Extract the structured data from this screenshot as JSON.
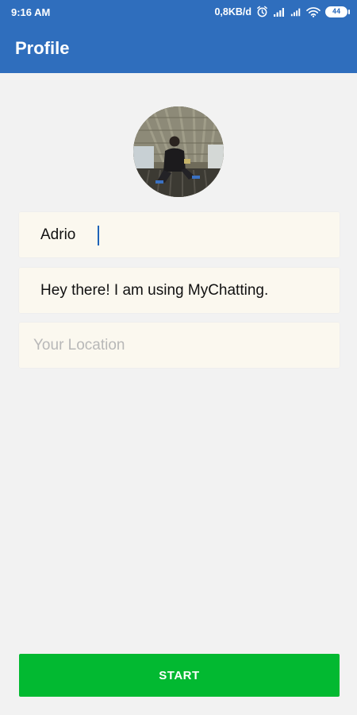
{
  "status_bar": {
    "time": "9:16 AM",
    "net_speed": "0,8KB/d",
    "battery": "44",
    "icons": [
      "alarm-icon",
      "signal-icon",
      "signal-icon",
      "wifi-icon",
      "battery-icon"
    ]
  },
  "toolbar": {
    "title": "Profile"
  },
  "avatar": {
    "icon": "profile-photo"
  },
  "form": {
    "name_value": "Adrio",
    "status_value": "Hey there! I am using MyChatting.",
    "location_value": "",
    "location_placeholder": "Your Location"
  },
  "start_button": {
    "label": "START"
  },
  "colors": {
    "app_bar": "#2f6ebd",
    "background": "#f2f2f2",
    "field_background": "#fbf8ef",
    "start_button": "#02b931",
    "caret": "#1e63b8"
  }
}
